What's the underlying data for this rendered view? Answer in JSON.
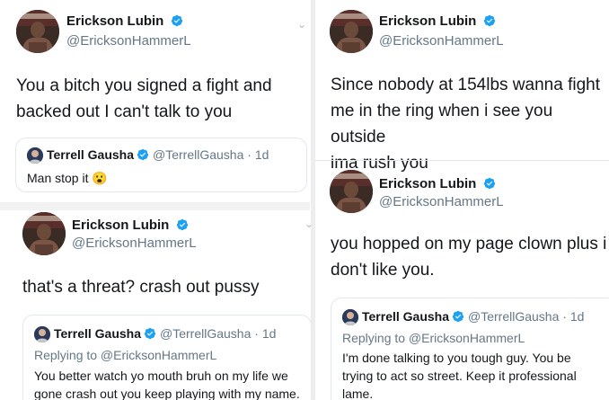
{
  "left": {
    "tweet1": {
      "name": "Erickson Lubin",
      "handle": "@EricksonHammerL",
      "text_line1": "You a bitch you signed a fight and",
      "text_line2": "backed out I can't talk to you",
      "quote": {
        "name": "Terrell Gausha",
        "handle_time": "@TerrellGausha · 1d",
        "text": "Man stop it",
        "emoji": "😮"
      }
    },
    "tweet2": {
      "name": "Erickson Lubin",
      "handle": "@EricksonHammerL",
      "text": "that's a threat? crash out pussy",
      "quote": {
        "name": "Terrell Gausha",
        "handle_time": "@TerrellGausha · 1d",
        "reply": "Replying to @EricksonHammerL",
        "text_line1": "You better watch yo mouth bruh on my life we",
        "text_line2": "gone crash out you keep playing with my name."
      }
    }
  },
  "right": {
    "tweet1": {
      "name": "Erickson Lubin",
      "handle": "@EricksonHammerL",
      "text_line1": "Since nobody at 154lbs wanna fight",
      "text_line2": "me in the ring when i see you outside",
      "text_line3": "ima rush you"
    },
    "tweet2": {
      "name": "Erickson Lubin",
      "handle": "@EricksonHammerL",
      "text_line1": "you hopped on my page clown plus i",
      "text_line2": "don't like you.",
      "quote": {
        "name": "Terrell Gausha",
        "handle_time": "@TerrellGausha · 1d",
        "reply": "Replying to @EricksonHammerL",
        "text_line1": "I'm done talking to you tough guy. You  be",
        "text_line2": "trying to act so street. Keep it professional",
        "text_line3": "lame."
      }
    }
  },
  "colors": {
    "verified": "#1da1f2",
    "secondary": "#657786",
    "border": "#e1e8ed"
  }
}
